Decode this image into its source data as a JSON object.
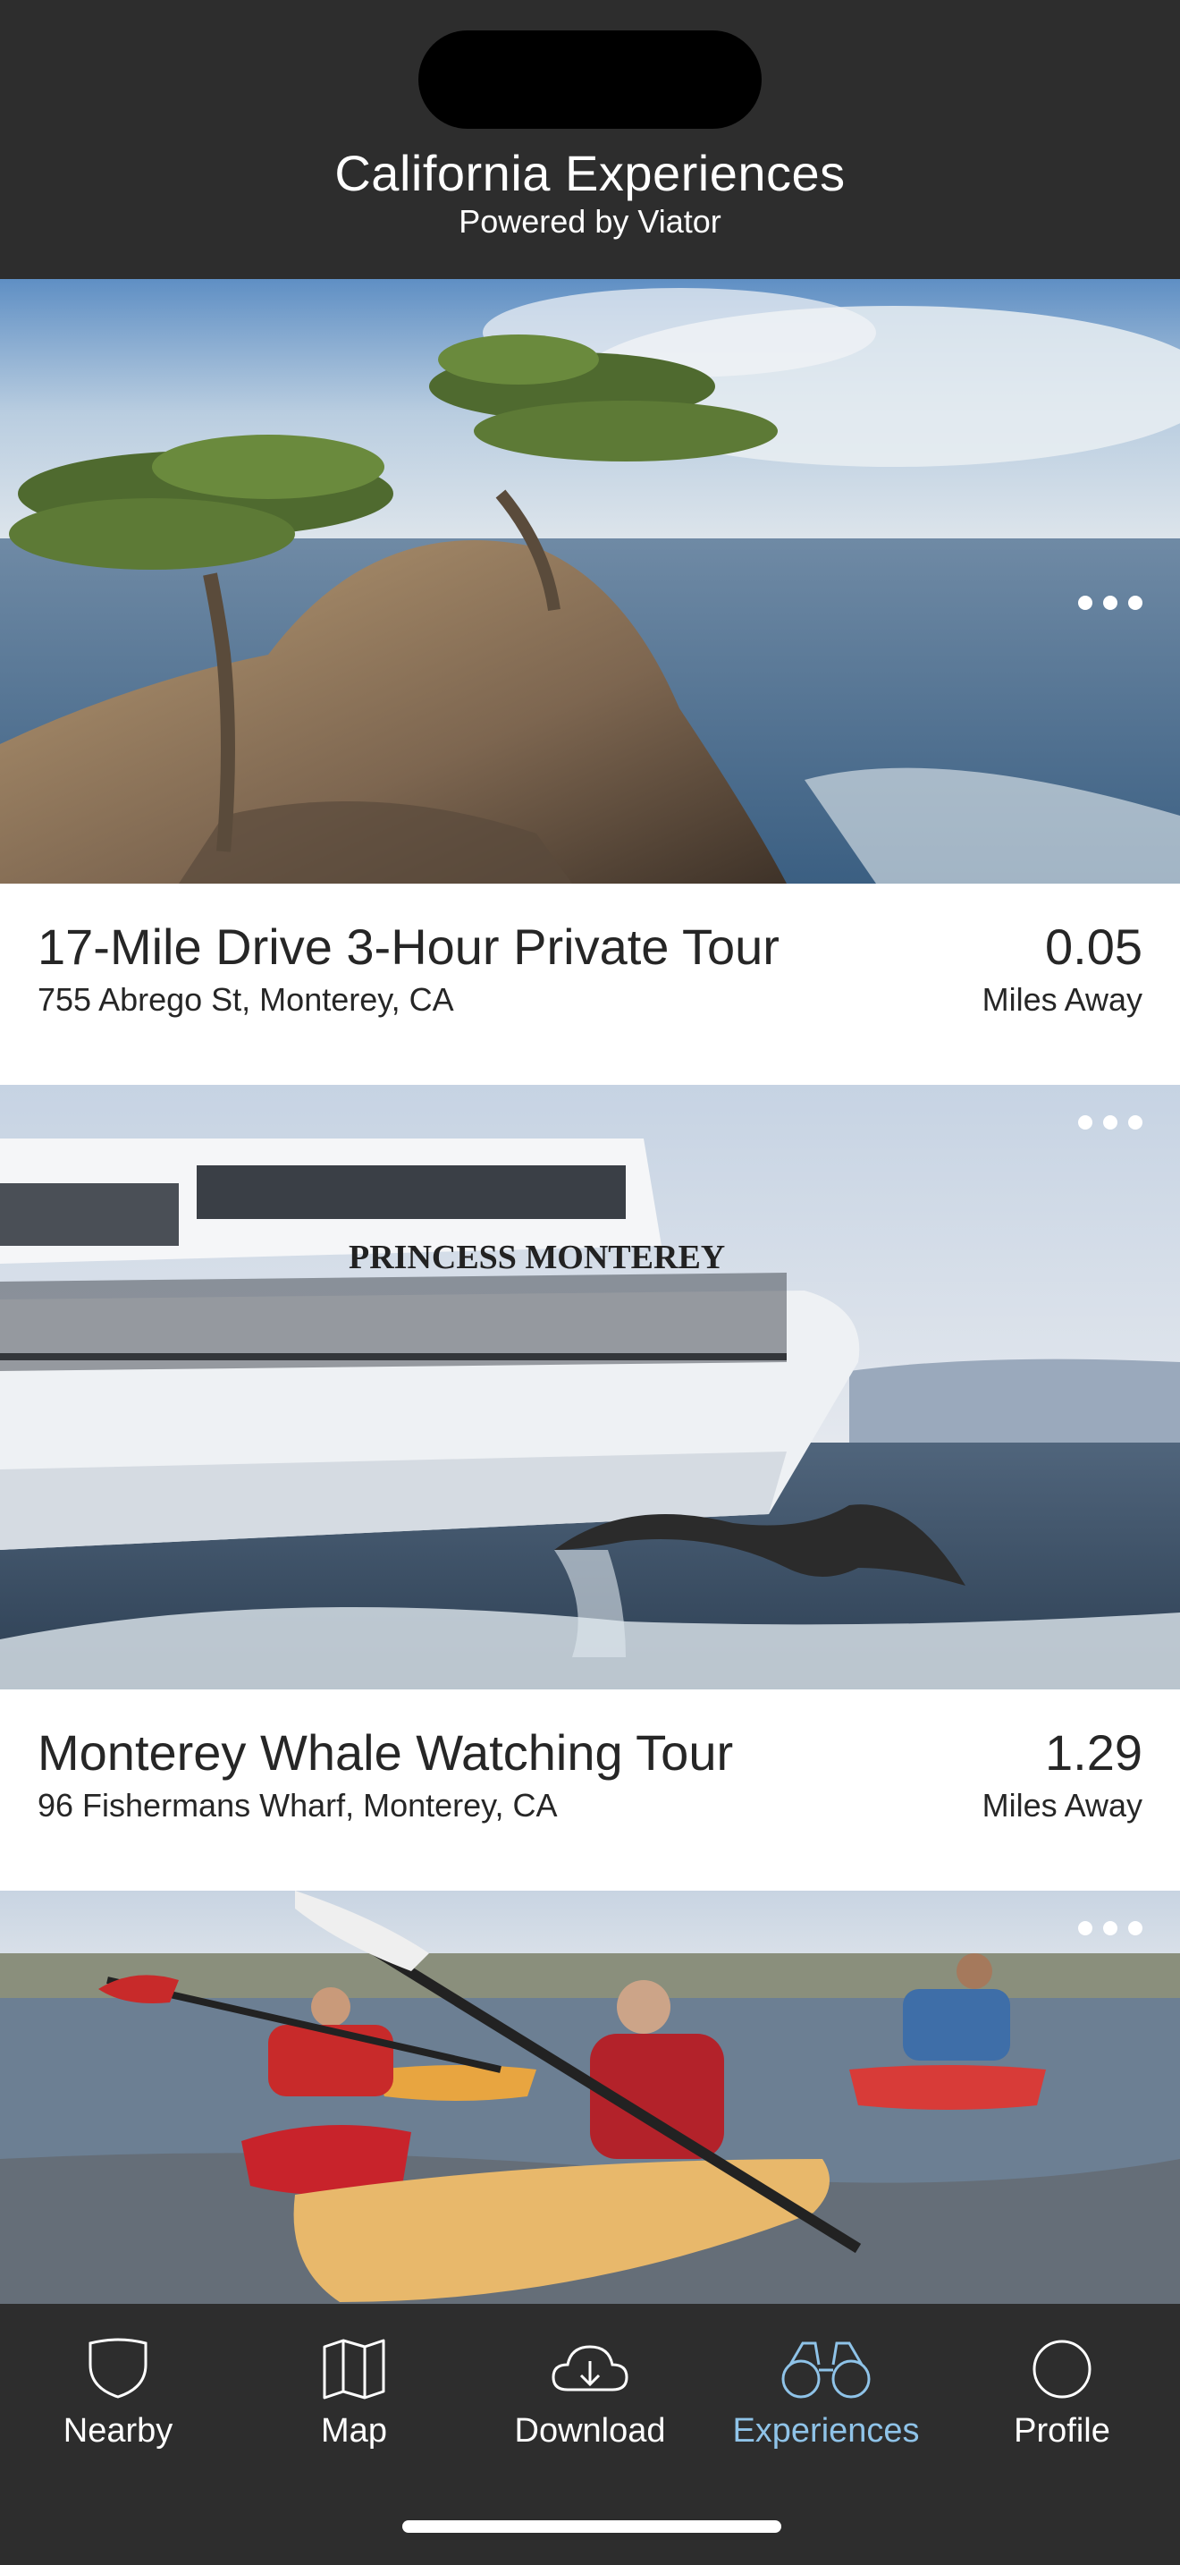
{
  "header": {
    "title": "California Experiences",
    "subtitle": "Powered by Viator"
  },
  "experiences": [
    {
      "name": "17-Mile Drive 3-Hour Private Tour",
      "address": "755 Abrego St, Monterey, CA",
      "distance": "0.05",
      "distance_unit": "Miles Away",
      "image": "cypress-tree-on-rocky-coast"
    },
    {
      "name": "Monterey Whale Watching Tour",
      "address": "96 Fishermans Wharf, Monterey, CA",
      "distance": "1.29",
      "distance_unit": "Miles Away",
      "image": "whale-watching-boat-with-whale-tail",
      "boat_sign": "PRINCESS MONTEREY"
    },
    {
      "image": "kayakers-on-bay"
    }
  ],
  "tabbar": {
    "tabs": [
      {
        "label": "Nearby",
        "icon": "shield-icon",
        "active": false
      },
      {
        "label": "Map",
        "icon": "map-icon",
        "active": false
      },
      {
        "label": "Download",
        "icon": "cloud-download-icon",
        "active": false
      },
      {
        "label": "Experiences",
        "icon": "binoculars-icon",
        "active": true
      },
      {
        "label": "Profile",
        "icon": "circle-profile-icon",
        "active": false
      }
    ]
  },
  "colors": {
    "header_bg": "#2d2d2d",
    "tabbar_bg": "#2d2d2d",
    "active_tab": "#8fc3e8",
    "text": "#262626"
  }
}
